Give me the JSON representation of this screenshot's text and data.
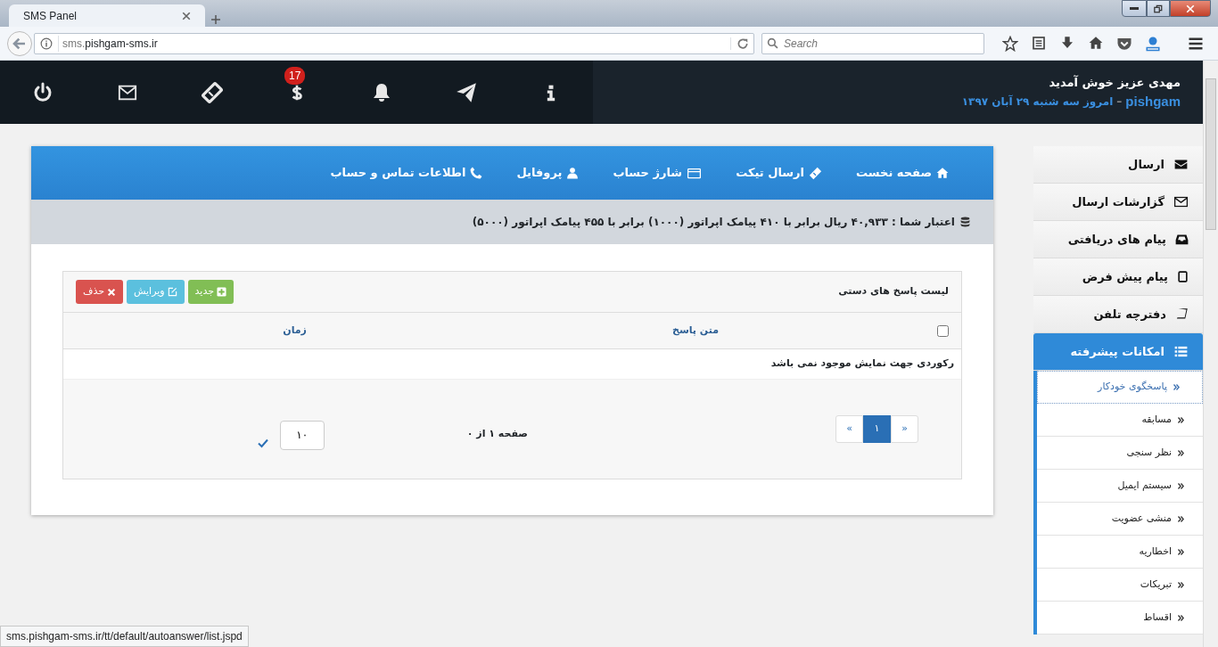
{
  "browser": {
    "tab_title": "SMS Panel",
    "url_prefix": "sms.",
    "url_domain": "pishgam-sms.ir",
    "search_placeholder": "Search",
    "status_url": "sms.pishgam-sms.ir/tt/default/autoanswer/list.jspd"
  },
  "header": {
    "greeting": "مهدی عزیز خوش آمدید",
    "user": "pishgam",
    "separator": "–",
    "date": "امروز سه شنبه ۲۹ آبان ۱۳۹۷",
    "icons": [
      {
        "kind": "info"
      },
      {
        "kind": "send"
      },
      {
        "kind": "bell"
      },
      {
        "kind": "dollar",
        "badge": "17"
      },
      {
        "kind": "ticket"
      },
      {
        "kind": "mail"
      },
      {
        "kind": "power"
      }
    ]
  },
  "topnav": [
    {
      "kind": "home",
      "label": "صفحه نخست"
    },
    {
      "kind": "ticket",
      "label": "ارسال تیکت"
    },
    {
      "kind": "card",
      "label": "شارژ حساب"
    },
    {
      "kind": "user",
      "label": "پروفایل"
    },
    {
      "kind": "phone",
      "label": "اطلاعات تماس و حساب"
    }
  ],
  "credit": "اعتبار شما : ۴۰,۹۳۳ ریال برابر با ۴۱۰ پیامک اپراتور (۱۰۰۰) برابر با ۴۵۵ پیامک اپراتور (۵۰۰۰)",
  "panel": {
    "title": "لیست پاسخ های دستی",
    "buttons": [
      {
        "kind": "new",
        "label": "جدید"
      },
      {
        "kind": "edit",
        "label": "ویرایش"
      },
      {
        "kind": "delete",
        "label": "حذف"
      }
    ],
    "select_all_checked": false,
    "columns": [
      "متن پاسخ",
      "زمان"
    ],
    "empty_message": "رکوردی جهت نمایش موجود نمی باشد",
    "pagination": {
      "prev": "«",
      "pages": [
        {
          "label": "۱",
          "selected": true
        }
      ],
      "next": "»",
      "summary": "صفحه ۱ از ۰",
      "page_size": "۱۰"
    }
  },
  "sidebar": {
    "items": [
      {
        "kind": "send",
        "label": "ارسال",
        "expanded": false
      },
      {
        "kind": "reports",
        "label": "گزارشات ارسال",
        "expanded": false
      },
      {
        "kind": "inbox",
        "label": "پیام های دریافتی",
        "expanded": false
      },
      {
        "kind": "presets",
        "label": "پیام پیش فرض",
        "expanded": false
      },
      {
        "kind": "contacts",
        "label": "دفترچه تلفن",
        "expanded": false
      },
      {
        "kind": "advanced",
        "label": "امکانات پیشرفته",
        "expanded": true,
        "children": [
          {
            "label": "پاسخگوی خودکار",
            "selected": true
          },
          {
            "label": "مسابقه",
            "selected": false
          },
          {
            "label": "نظر سنجی",
            "selected": false
          },
          {
            "label": "سیستم ایمیل",
            "selected": false
          },
          {
            "label": "منشی عضویت",
            "selected": false
          },
          {
            "label": "اخطاریه",
            "selected": false
          },
          {
            "label": "تبریکات",
            "selected": false
          },
          {
            "label": "اقساط",
            "selected": false
          }
        ]
      }
    ]
  }
}
